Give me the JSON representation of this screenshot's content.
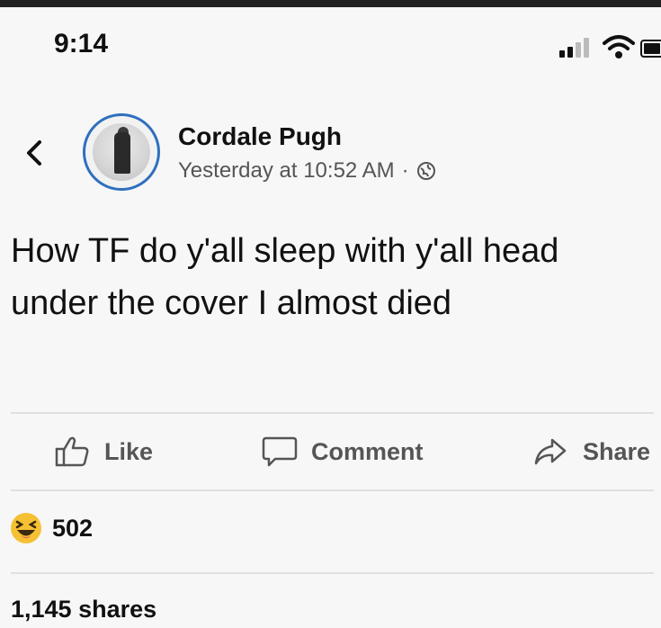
{
  "status_bar": {
    "time": "9:14"
  },
  "post": {
    "author_name": "Cordale Pugh",
    "timestamp": "Yesterday at 10:52 AM",
    "separator": "·",
    "text": "How TF do y'all sleep with y'all head under the cover I almost died"
  },
  "actions": {
    "like": "Like",
    "comment": "Comment",
    "share": "Share"
  },
  "reactions": {
    "count": "502",
    "type": "haha-emoji"
  },
  "shares_text": "1,145 shares",
  "colors": {
    "avatar_ring": "#2f6fbf",
    "haha_yellow": "#f5c033"
  }
}
